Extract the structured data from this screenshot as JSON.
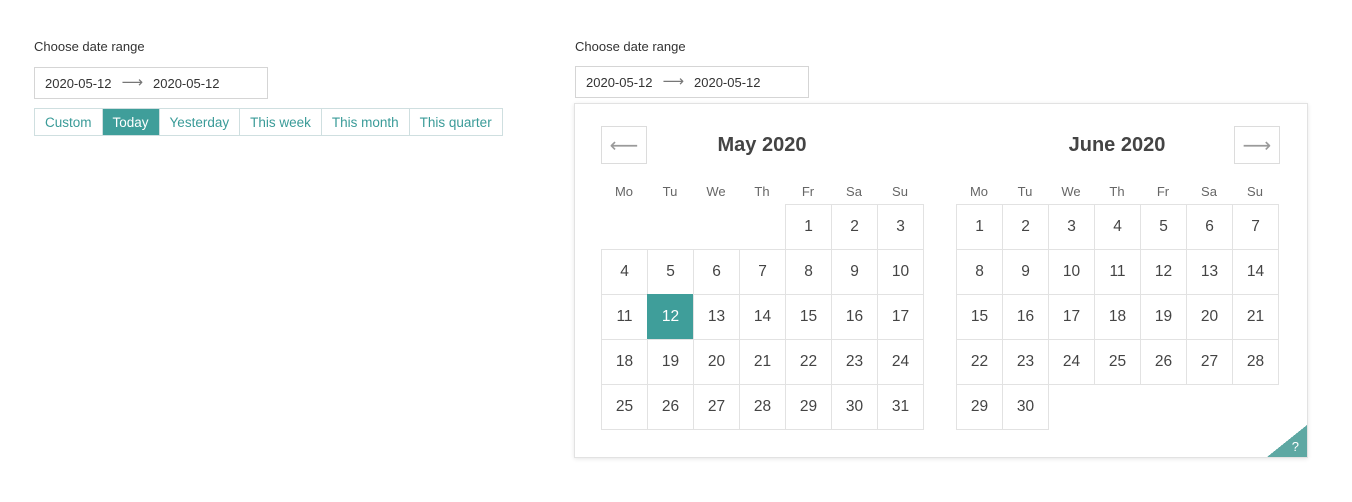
{
  "left": {
    "label": "Choose date range",
    "start": "2020-05-12",
    "arrow": "⟶",
    "end": "2020-05-12",
    "presets": [
      {
        "label": "Custom",
        "active": false
      },
      {
        "label": "Today",
        "active": true
      },
      {
        "label": "Yesterday",
        "active": false
      },
      {
        "label": "This week",
        "active": false
      },
      {
        "label": "This month",
        "active": false
      },
      {
        "label": "This quarter",
        "active": false
      }
    ]
  },
  "right": {
    "label": "Choose date range",
    "start": "2020-05-12",
    "arrow": "⟶",
    "end": "2020-05-12"
  },
  "calendar": {
    "prev_icon": "⟵",
    "next_icon": "⟶",
    "weekdays": [
      "Mo",
      "Tu",
      "We",
      "Th",
      "Fr",
      "Sa",
      "Su"
    ],
    "months": [
      {
        "title": "May 2020",
        "first_weekday_index": 4,
        "days": 31,
        "selected_day": 12
      },
      {
        "title": "June 2020",
        "first_weekday_index": 0,
        "days": 30,
        "selected_day": null
      }
    ],
    "help": "?"
  },
  "colors": {
    "accent": "#3f9e9a",
    "link": "#3a9b98"
  }
}
